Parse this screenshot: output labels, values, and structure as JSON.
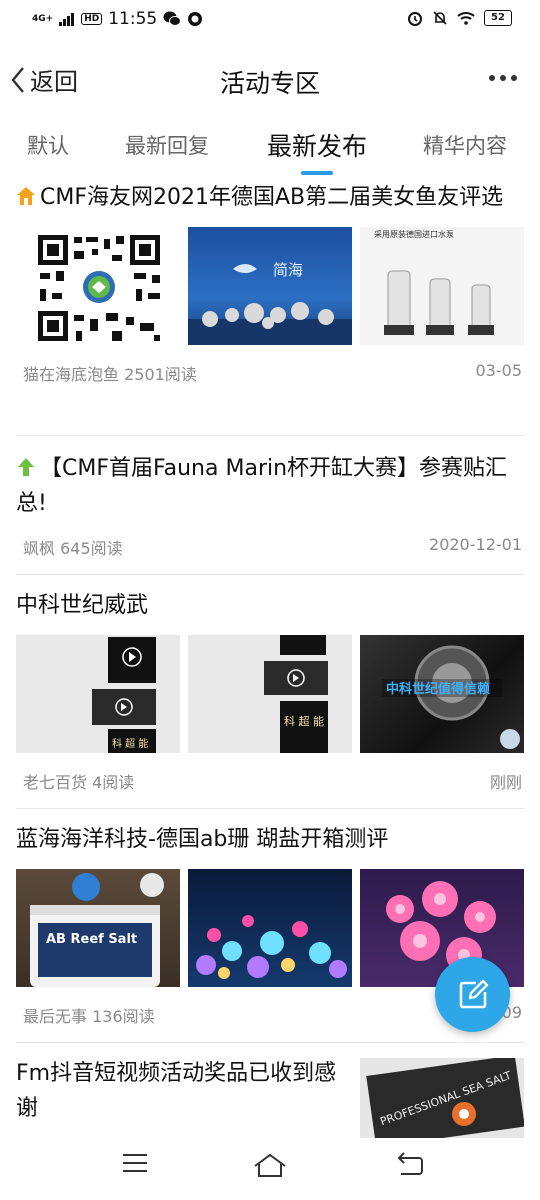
{
  "status_bar": {
    "network": "4G+",
    "hd": "HD",
    "time": "11:55",
    "battery": "52"
  },
  "nav": {
    "back_label": "返回",
    "title": "活动专区",
    "more_label": "···"
  },
  "tabs": [
    {
      "label": "默认",
      "active": false
    },
    {
      "label": "最新回复",
      "active": false
    },
    {
      "label": "最新发布",
      "active": true
    },
    {
      "label": "精华内容",
      "active": false
    }
  ],
  "posts": [
    {
      "title": "CMF海友网2021年德国AB第二届美女鱼友评选",
      "tag_icon": "house-icon-orange",
      "author_reads": "猫在海底泡鱼 2501阅读",
      "date": "03-05",
      "images": [
        "qr-code-image",
        "aquarium-blue-tank-image",
        "protein-skimmer-image"
      ],
      "image_texts": {
        "brand": "简海",
        "skimmer_caption": "采用原装德国进口水泵"
      }
    },
    {
      "title": "【CMF首届Fauna Marin杯开缸大赛】参赛贴汇总!",
      "tag_icon": "arrow-up-icon-green",
      "author_reads": "飒枫 645阅读",
      "date": "2020-12-01",
      "images": []
    },
    {
      "title": "中科世纪威武",
      "author_reads": "老七百货 4阅读",
      "date": "刚刚",
      "images": [
        "video-screenshot-image-1",
        "video-screenshot-image-2",
        "pump-product-image"
      ],
      "image_texts": {
        "overlay": "中科世纪值得信赖",
        "small_text": "科 超 能"
      }
    },
    {
      "title": "蓝海海洋科技-德国ab珊 瑚盐开箱测评",
      "author_reads": "最后无事 136阅读",
      "date": "09",
      "images": [
        "reef-salt-bucket-image",
        "coral-tank-image",
        "coral-closeup-image"
      ],
      "image_texts": {
        "bucket": "AB Reef Salt"
      }
    },
    {
      "title": "Fm抖音短视频活动奖品已收到感谢",
      "images": [
        "sea-salt-box-image"
      ],
      "image_texts": {
        "box": "PROFESSIONAL SEA SALT"
      }
    }
  ],
  "colors": {
    "accent": "#2c9be7",
    "fab": "#2ea7e9",
    "meta_text": "#8a8a8a"
  }
}
